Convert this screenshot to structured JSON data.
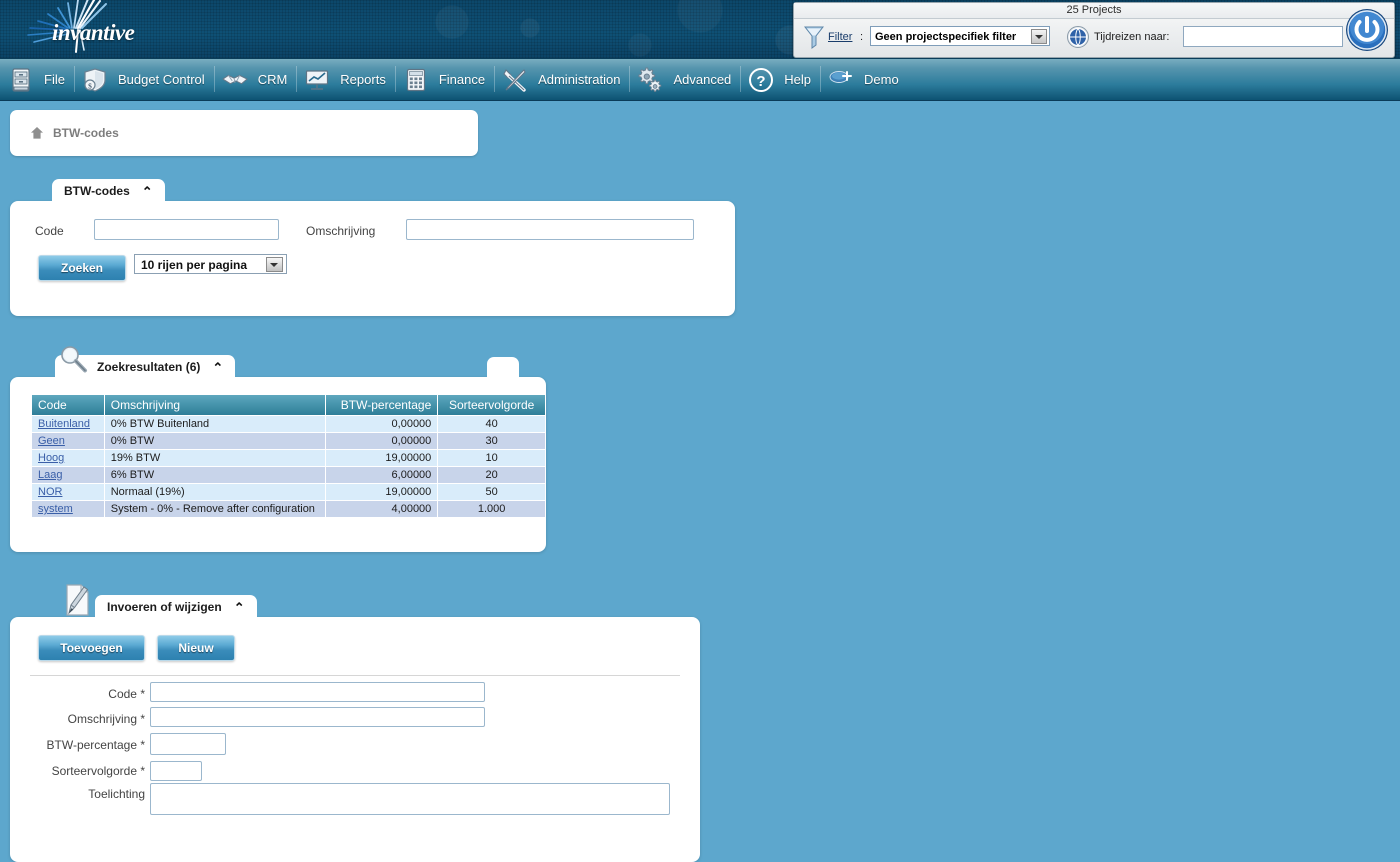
{
  "app": {
    "brand": "invantive",
    "logo_icon": "invantive-burst-logo"
  },
  "projectbar": {
    "title": "25 Projects",
    "filter_icon": "funnel-icon",
    "filter_label": "Filter",
    "filter_colon": ":",
    "filter_value": "Geen projectspecifiek filter",
    "filter_options": [
      "Geen projectspecifiek filter"
    ],
    "clock_icon": "clock-globe-icon",
    "timetravel_label": "Tijdreizen naar:",
    "timetravel_value": "",
    "timetravel_placeholder": "",
    "power_icon": "power-icon"
  },
  "nav": {
    "items": [
      {
        "icon": "file-cabinet-icon",
        "label": "File"
      },
      {
        "icon": "money-shield-icon",
        "label": "Budget Control"
      },
      {
        "icon": "handshake-icon",
        "label": "CRM"
      },
      {
        "icon": "presentation-chart-icon",
        "label": "Reports"
      },
      {
        "icon": "calculator-icon",
        "label": "Finance"
      },
      {
        "icon": "tools-wrench-screwdriver-icon",
        "label": "Administration"
      },
      {
        "icon": "gears-icon",
        "label": "Advanced"
      },
      {
        "icon": "question-circle-icon",
        "label": "Help"
      },
      {
        "icon": "user-add-icon",
        "label": "Demo"
      }
    ]
  },
  "breadcrumb": {
    "home_icon": "home-icon",
    "text": "BTW-codes"
  },
  "search_panel": {
    "tab_label": "BTW-codes",
    "collapse_icon": "chevron-up-icon",
    "code_label": "Code",
    "code_value": "",
    "omschrijving_label": "Omschrijving",
    "omschrijving_value": "",
    "search_button": "Zoeken",
    "rows_per_page_value": "10 rijen per pagina",
    "rows_per_page_options": [
      "10 rijen per pagina"
    ]
  },
  "results_panel": {
    "tab_icon": "magnifier-icon",
    "tab_label": "Zoekresultaten (6)",
    "collapse_icon": "chevron-up-icon",
    "columns": [
      "Code",
      "Omschrijving",
      "BTW-percentage",
      "Sorteervolgorde"
    ],
    "rows": [
      {
        "code": "Buitenland",
        "omschrijving": "0% BTW Buitenland",
        "percentage": "0,00000",
        "sorteervolgorde": "40"
      },
      {
        "code": "Geen",
        "omschrijving": "0% BTW",
        "percentage": "0,00000",
        "sorteervolgorde": "30"
      },
      {
        "code": "Hoog",
        "omschrijving": "19% BTW",
        "percentage": "19,00000",
        "sorteervolgorde": "10"
      },
      {
        "code": "Laag",
        "omschrijving": "6% BTW",
        "percentage": "6,00000",
        "sorteervolgorde": "20"
      },
      {
        "code": "NOR",
        "omschrijving": "Normaal (19%)",
        "percentage": "19,00000",
        "sorteervolgorde": "50"
      },
      {
        "code": "system",
        "omschrijving": "System - 0% - Remove after configuration",
        "percentage": "4,00000",
        "sorteervolgorde": "1.000"
      }
    ]
  },
  "edit_panel": {
    "tab_icon": "pencil-page-icon",
    "tab_label": "Invoeren of wijzigen",
    "collapse_icon": "chevron-up-icon",
    "add_button": "Toevoegen",
    "new_button": "Nieuw",
    "fields": [
      {
        "label": "Code *",
        "value": ""
      },
      {
        "label": "Omschrijving *",
        "value": ""
      },
      {
        "label": "BTW-percentage *",
        "value": ""
      },
      {
        "label": "Sorteervolgorde *",
        "value": ""
      },
      {
        "label": "Toelichting",
        "value": ""
      }
    ]
  },
  "colors": {
    "page_background": "#5da7cd",
    "banner_dark": "#0d4a6b",
    "nav_gradient_top": "#79adc0",
    "nav_gradient_bottom": "#0d5272",
    "grid_header": "#4795ad",
    "grid_row_odd": "#d9ecfa",
    "grid_row_even": "#c8d4ea",
    "link": "#3a5fa8",
    "button_blue": "#3a8cba"
  }
}
